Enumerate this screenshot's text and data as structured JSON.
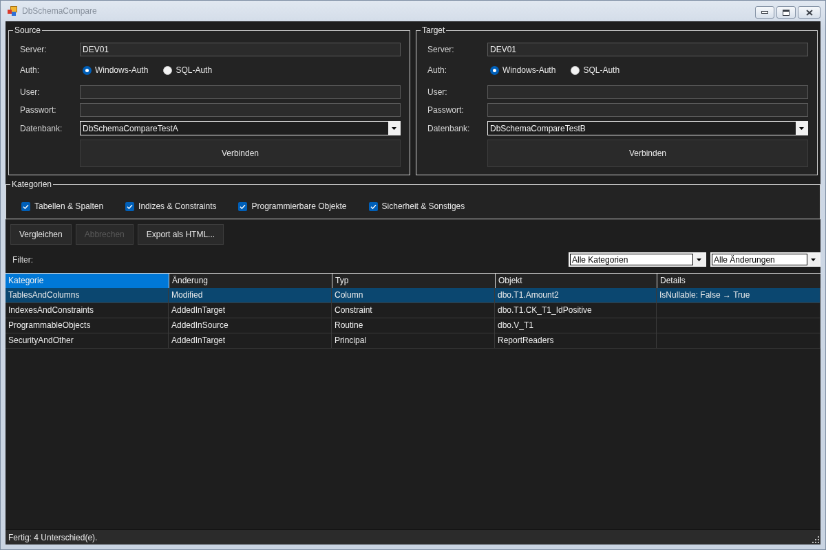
{
  "window": {
    "title": "DbSchemaCompare"
  },
  "connections": [
    {
      "legend": "Source",
      "server_label": "Server:",
      "server": "DEV01",
      "auth_label": "Auth:",
      "auth_options": [
        {
          "label": "Windows-Auth",
          "selected": true
        },
        {
          "label": "SQL-Auth",
          "selected": false
        }
      ],
      "user_label": "User:",
      "password_label": "Passwort:",
      "database_label": "Datenbank:",
      "database": "DbSchemaCompareTestA",
      "connect_button": "Verbinden"
    },
    {
      "legend": "Target",
      "server_label": "Server:",
      "server": "DEV01",
      "auth_label": "Auth:",
      "auth_options": [
        {
          "label": "Windows-Auth",
          "selected": true
        },
        {
          "label": "SQL-Auth",
          "selected": false
        }
      ],
      "user_label": "User:",
      "password_label": "Passwort:",
      "database_label": "Datenbank:",
      "database": "DbSchemaCompareTestB",
      "connect_button": "Verbinden"
    }
  ],
  "categories": {
    "legend": "Kategorien",
    "items": [
      {
        "label": "Tabellen & Spalten",
        "checked": true
      },
      {
        "label": "Indizes & Constraints",
        "checked": true
      },
      {
        "label": "Programmierbare Objekte",
        "checked": true
      },
      {
        "label": "Sicherheit & Sonstiges",
        "checked": true
      }
    ]
  },
  "actions": [
    {
      "label": "Vergleichen",
      "disabled": false
    },
    {
      "label": "Abbrechen",
      "disabled": true
    },
    {
      "label": "Export als HTML...",
      "disabled": false
    }
  ],
  "filter": {
    "label": "Filter:",
    "dropdowns": [
      {
        "value": "Alle Kategorien"
      },
      {
        "value": "Alle Änderungen"
      }
    ]
  },
  "table": {
    "columns": [
      {
        "label": "Kategorie",
        "selected": true
      },
      {
        "label": "Änderung",
        "selected": false
      },
      {
        "label": "Typ",
        "selected": false
      },
      {
        "label": "Objekt",
        "selected": false
      },
      {
        "label": "Details",
        "selected": false
      }
    ],
    "rows": [
      {
        "cells": [
          "TablesAndColumns",
          "Modified",
          "Column",
          "dbo.T1.Amount2",
          "IsNullable: False → True"
        ],
        "selected": true
      },
      {
        "cells": [
          "IndexesAndConstraints",
          "AddedInTarget",
          "Constraint",
          "dbo.T1.CK_T1_IdPositive"
        ],
        "selected": false
      },
      {
        "cells": [
          "ProgrammableObjects",
          "AddedInSource",
          "Routine",
          "dbo.V_T1"
        ],
        "selected": false
      },
      {
        "cells": [
          "SecurityAndOther",
          "AddedInTarget",
          "Principal",
          "ReportReaders"
        ],
        "selected": false
      }
    ]
  },
  "status_bar": {
    "text": "Fertig: 4 Unterschied(e)."
  }
}
